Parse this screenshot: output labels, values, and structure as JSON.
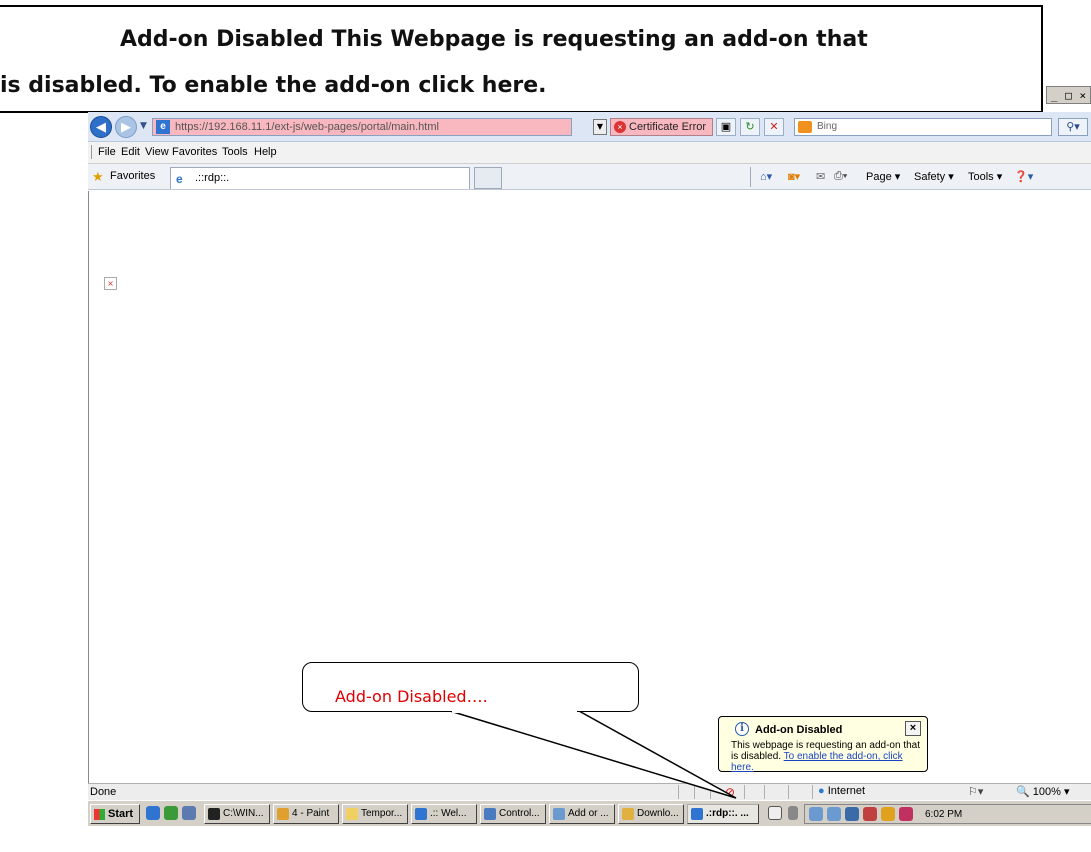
{
  "annotation": {
    "line1": "Add-on Disabled This Webpage is requesting an add-on that",
    "line2": "is disabled. To enable the add-on click here."
  },
  "window_controls": "_□×",
  "browser": {
    "url": "https://192.168.11.1/ext-js/web-pages/portal/main.html",
    "certificate_error": "Certificate Error",
    "search_placeholder": "Bing",
    "menu": [
      "File",
      "Edit",
      "View",
      "Favorites",
      "Tools",
      "Help"
    ],
    "favorites_label": "Favorites",
    "tab_title": ".::rdp::.",
    "commands": [
      "Page ▾",
      "Safety ▾",
      "Tools ▾"
    ],
    "status_text": "Done",
    "zone": "Internet",
    "zoom": "100%"
  },
  "balloon": {
    "title": "Add-on Disabled",
    "body": "This webpage is requesting an add-on that is disabled.",
    "link": "To enable the add-on, click here."
  },
  "callout": {
    "text": "Add-on Disabled…."
  },
  "taskbar": {
    "start": "Start",
    "tasks": [
      "C:\\WIN...",
      "4 - Paint",
      "Tempor...",
      ".:: Wel...",
      "Control...",
      "Add or ...",
      "Downlo...",
      ".:rdp::. ..."
    ],
    "clock": "6:02 PM"
  },
  "colors": {
    "url_bar_error": "#f9b8c0",
    "balloon_bg": "#ffffe1",
    "callout_text": "#e00000"
  }
}
